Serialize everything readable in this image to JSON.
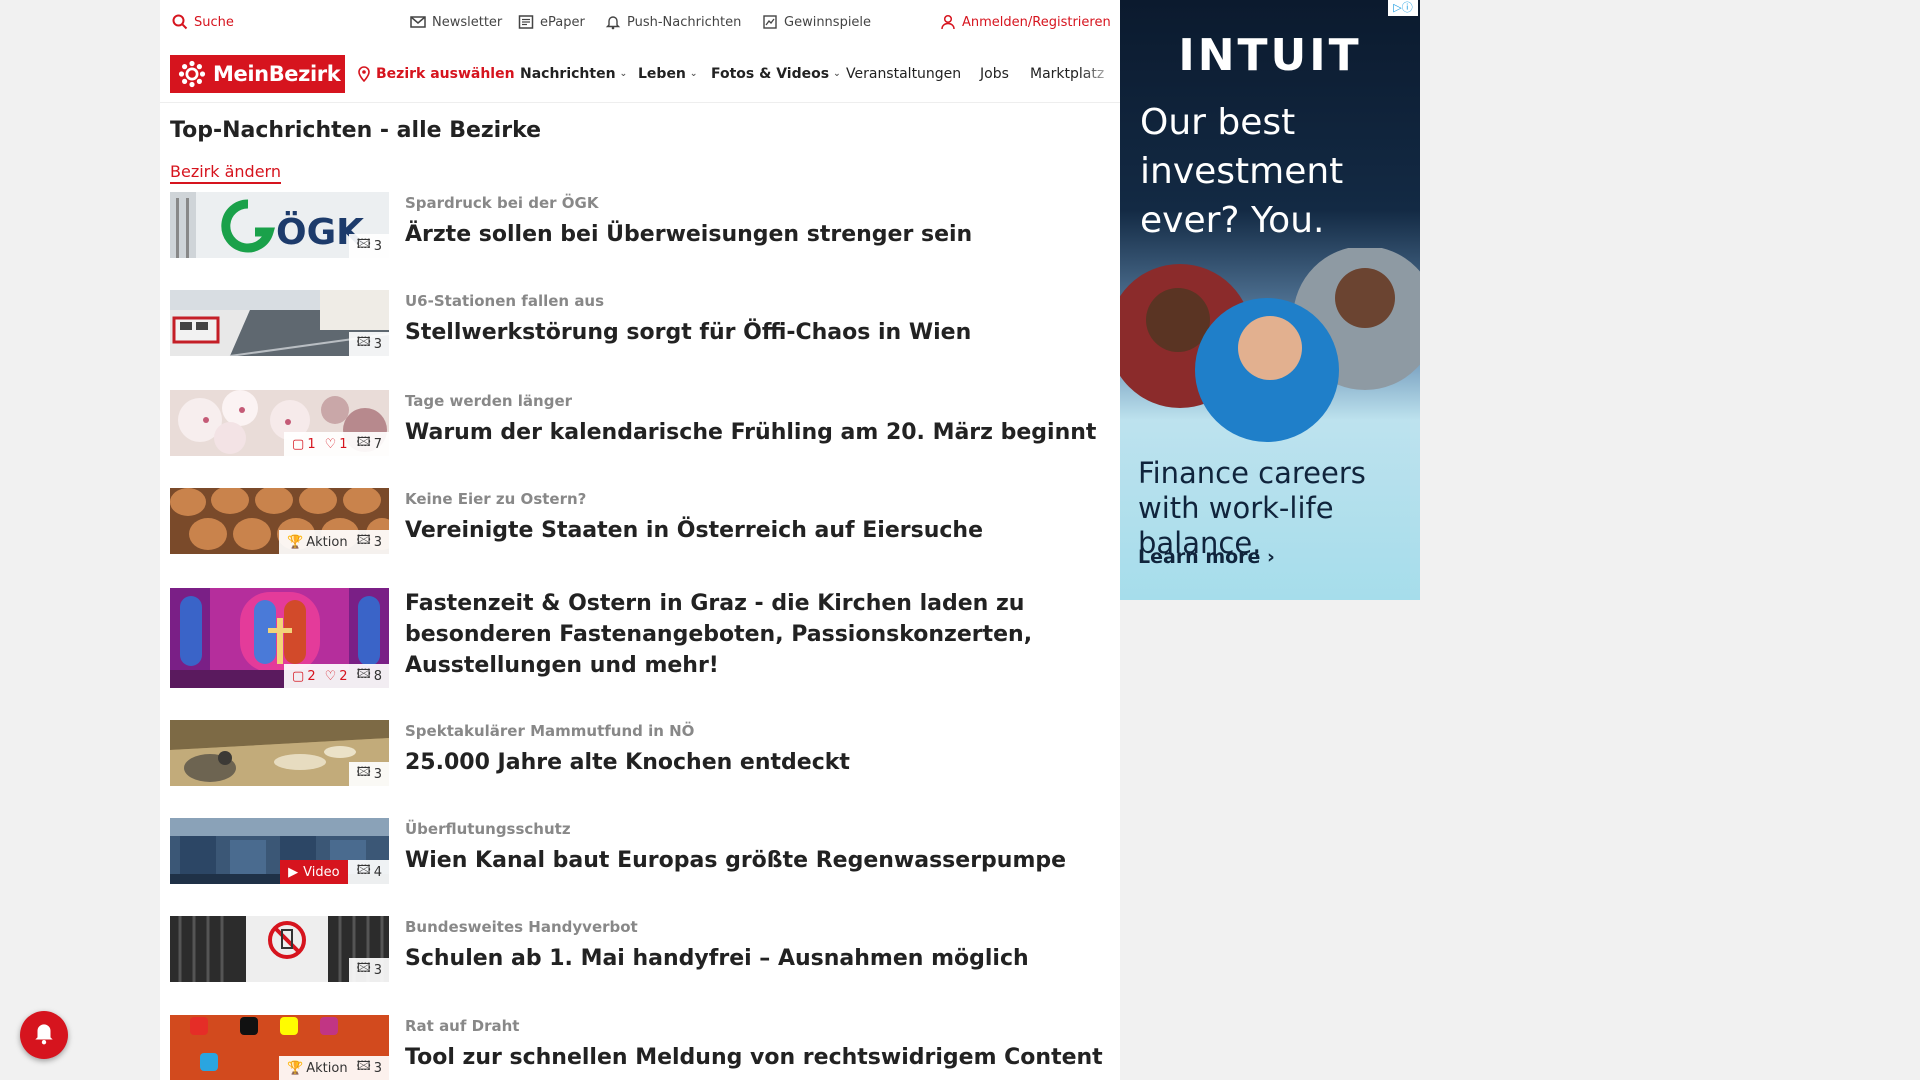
{
  "topbar": {
    "search_label": "Suche",
    "newsletter_label": "Newsletter",
    "epaper_label": "ePaper",
    "push_label": "Push-Nachrichten",
    "games_label": "Gewinnspiele",
    "login_label": "Anmelden/Registrieren"
  },
  "nav": {
    "logo_text": "MeinBezirk",
    "district_select": "Bezirk auswählen",
    "items": [
      {
        "label": "Nachrichten",
        "dropdown": true
      },
      {
        "label": "Leben",
        "dropdown": true
      },
      {
        "label": "Fotos & Videos",
        "dropdown": true
      },
      {
        "label": "Veranstaltungen",
        "dropdown": false
      },
      {
        "label": "Jobs",
        "dropdown": false
      },
      {
        "label": "Marktplatz",
        "dropdown": false
      }
    ]
  },
  "main": {
    "title": "Top-Nachrichten - alle Bezirke",
    "change_link": "Bezirk ändern"
  },
  "articles": [
    {
      "kicker": "Spardruck bei der ÖGK",
      "headline": "Ärzte sollen bei Überweisungen strenger sein",
      "thumb_text": "ÖGK",
      "comments": "",
      "likes": "",
      "images": "3",
      "action": "",
      "video": ""
    },
    {
      "kicker": "U6-Stationen fallen aus",
      "headline": "Stellwerkstörung sorgt für Öffi-Chaos in Wien",
      "thumb_text": "",
      "comments": "",
      "likes": "",
      "images": "3",
      "action": "",
      "video": ""
    },
    {
      "kicker": "Tage werden länger",
      "headline": "Warum der kalendarische Frühling am 20. März beginnt",
      "thumb_text": "",
      "comments": "1",
      "likes": "1",
      "images": "7",
      "action": "",
      "video": ""
    },
    {
      "kicker": "Keine Eier zu Ostern?",
      "headline": "Vereinigte Staaten in Österreich auf Eiersuche",
      "thumb_text": "",
      "comments": "",
      "likes": "",
      "images": "3",
      "action": "Aktion",
      "video": ""
    },
    {
      "kicker": "",
      "headline": "Fastenzeit & Ostern in Graz - die Kirchen laden zu besonderen Fastenangeboten, Passionskonzerten, Ausstellungen und mehr!",
      "thumb_text": "",
      "comments": "2",
      "likes": "2",
      "images": "8",
      "action": "",
      "video": ""
    },
    {
      "kicker": "Spektakulärer Mammutfund in NÖ",
      "headline": "25.000 Jahre alte Knochen entdeckt",
      "thumb_text": "",
      "comments": "",
      "likes": "",
      "images": "3",
      "action": "",
      "video": ""
    },
    {
      "kicker": "Überflutungsschutz",
      "headline": "Wien Kanal baut Europas größte Regenwasserpumpe",
      "thumb_text": "",
      "comments": "",
      "likes": "",
      "images": "4",
      "action": "",
      "video": "Video"
    },
    {
      "kicker": "Bundesweites Handyverbot",
      "headline": "Schulen ab 1. Mai handyfrei – Ausnahmen möglich",
      "thumb_text": "",
      "comments": "",
      "likes": "",
      "images": "3",
      "action": "",
      "video": ""
    },
    {
      "kicker": "Rat auf Draht",
      "headline": "Tool zur schnellen Meldung von rechtswidrigem Content",
      "thumb_text": "",
      "comments": "",
      "likes": "",
      "images": "3",
      "action": "Aktion",
      "video": ""
    }
  ],
  "ad": {
    "brand": "INTUIT",
    "copy": "Our best investment ever? You.",
    "subcopy": "Finance careers with work-life balance.",
    "cta": "Learn more ›",
    "choices": "▷ⓘ"
  },
  "colors": {
    "accent": "#d6141e",
    "text": "#222222",
    "muted": "#888888"
  }
}
